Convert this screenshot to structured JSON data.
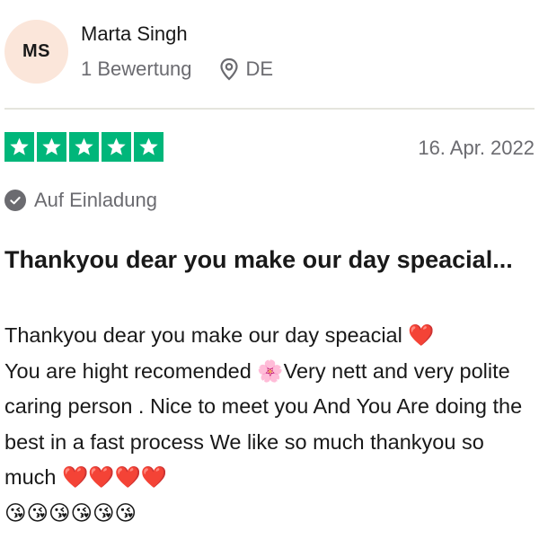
{
  "reviewer": {
    "initials": "MS",
    "name": "Marta Singh",
    "review_count": "1 Bewertung",
    "country": "DE"
  },
  "review": {
    "rating": 5,
    "rating_max": 5,
    "date": "16. Apr. 2022",
    "invite_label": "Auf Einladung",
    "title": "Thankyou dear you make our day speacial...",
    "body": "Thankyou dear you make our day speacial ❤️\nYou are hight recomended 🌸Very nett and very polite caring person . Nice to meet you And You Are doing the best in a fast process We like so much thankyou so much ❤️❤️❤️❤️\n😘😘😘😘😘😘"
  },
  "colors": {
    "star_green": "#00b67a",
    "avatar_bg": "#fbe6da",
    "muted_text": "#6b6b70"
  },
  "icons": [
    "location-pin-icon",
    "star-icon",
    "verified-check-icon"
  ]
}
